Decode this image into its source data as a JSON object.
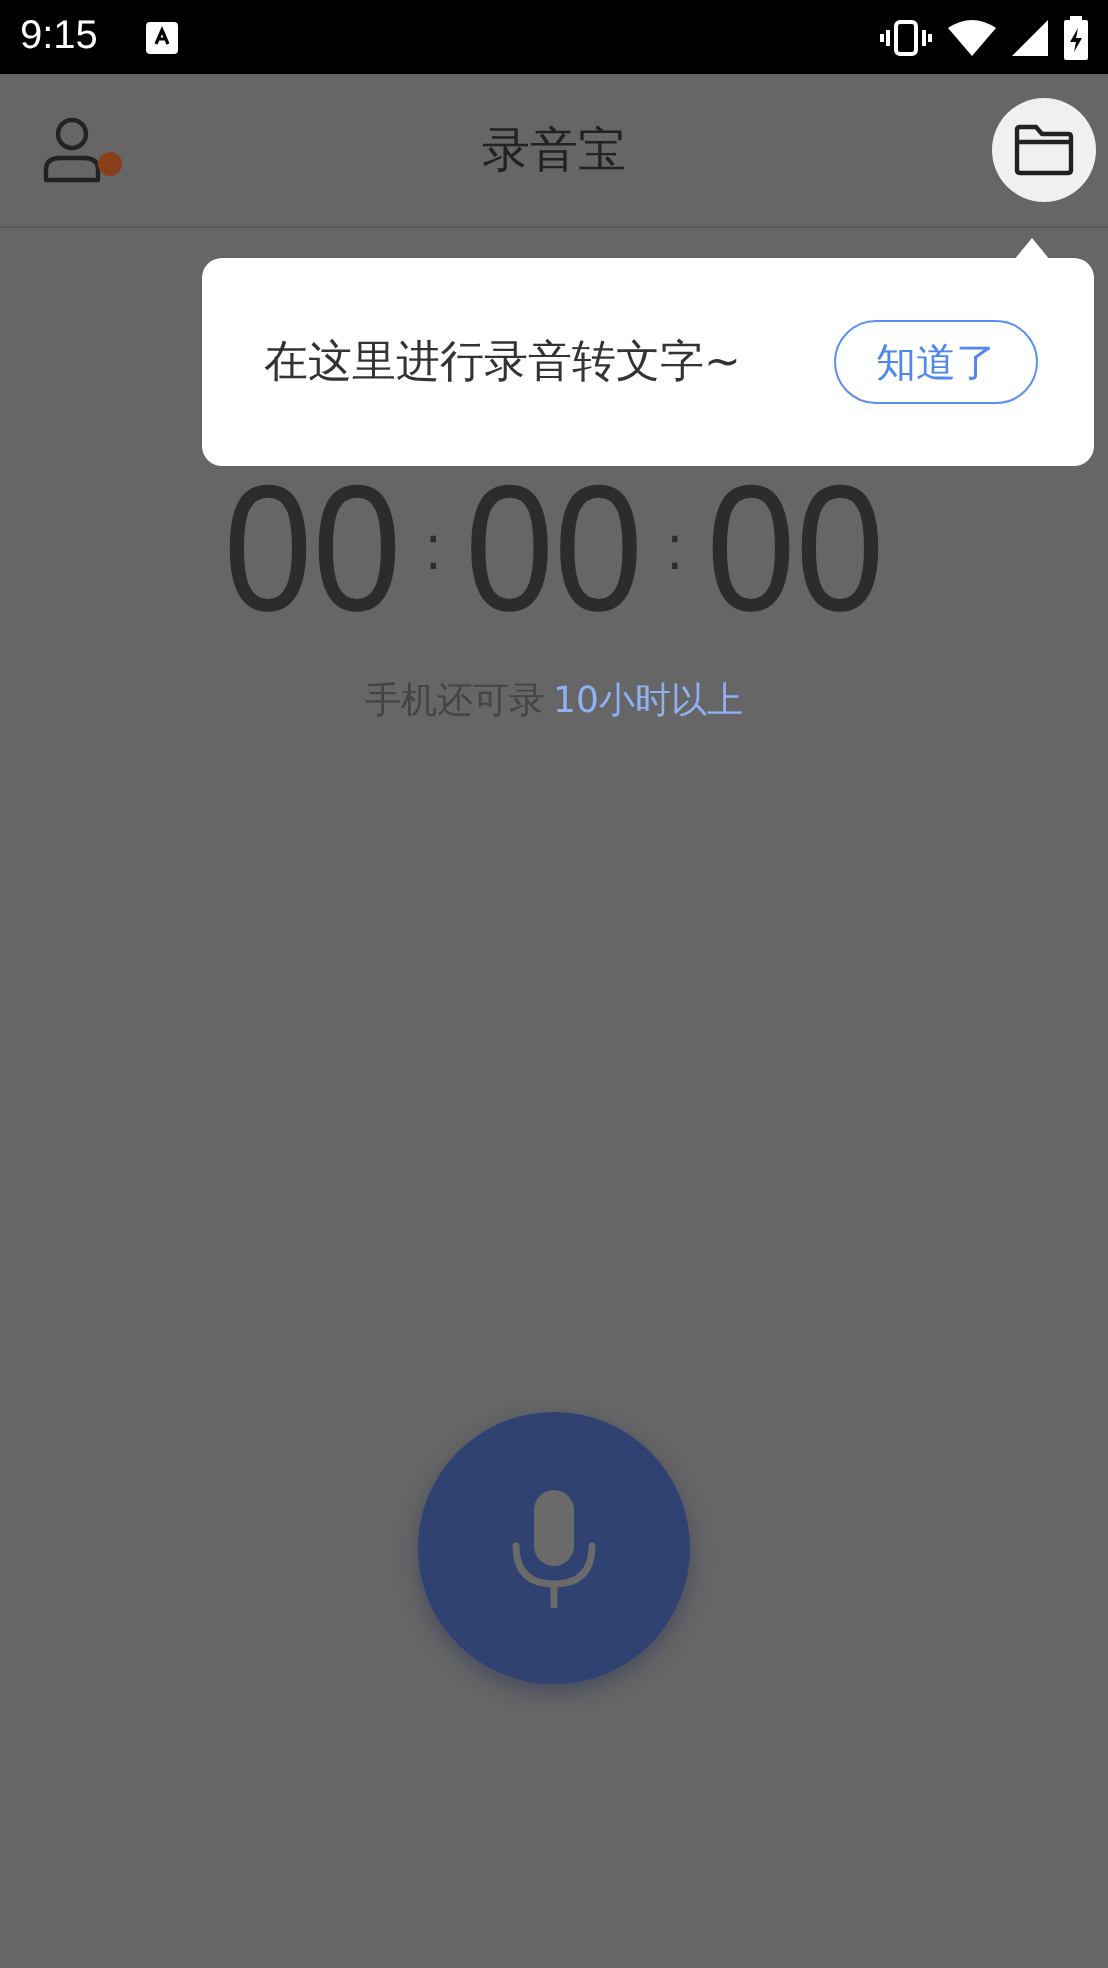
{
  "status_bar": {
    "time": "9:15"
  },
  "app_bar": {
    "title": "录音宝",
    "notification_dot": true
  },
  "tooltip": {
    "message": "在这里进行录音转文字~",
    "button": "知道了"
  },
  "timer": {
    "parts": [
      "00",
      ":",
      "00",
      ":",
      "00"
    ]
  },
  "remaining": {
    "label": "手机还可录",
    "value": "10小时以上"
  }
}
